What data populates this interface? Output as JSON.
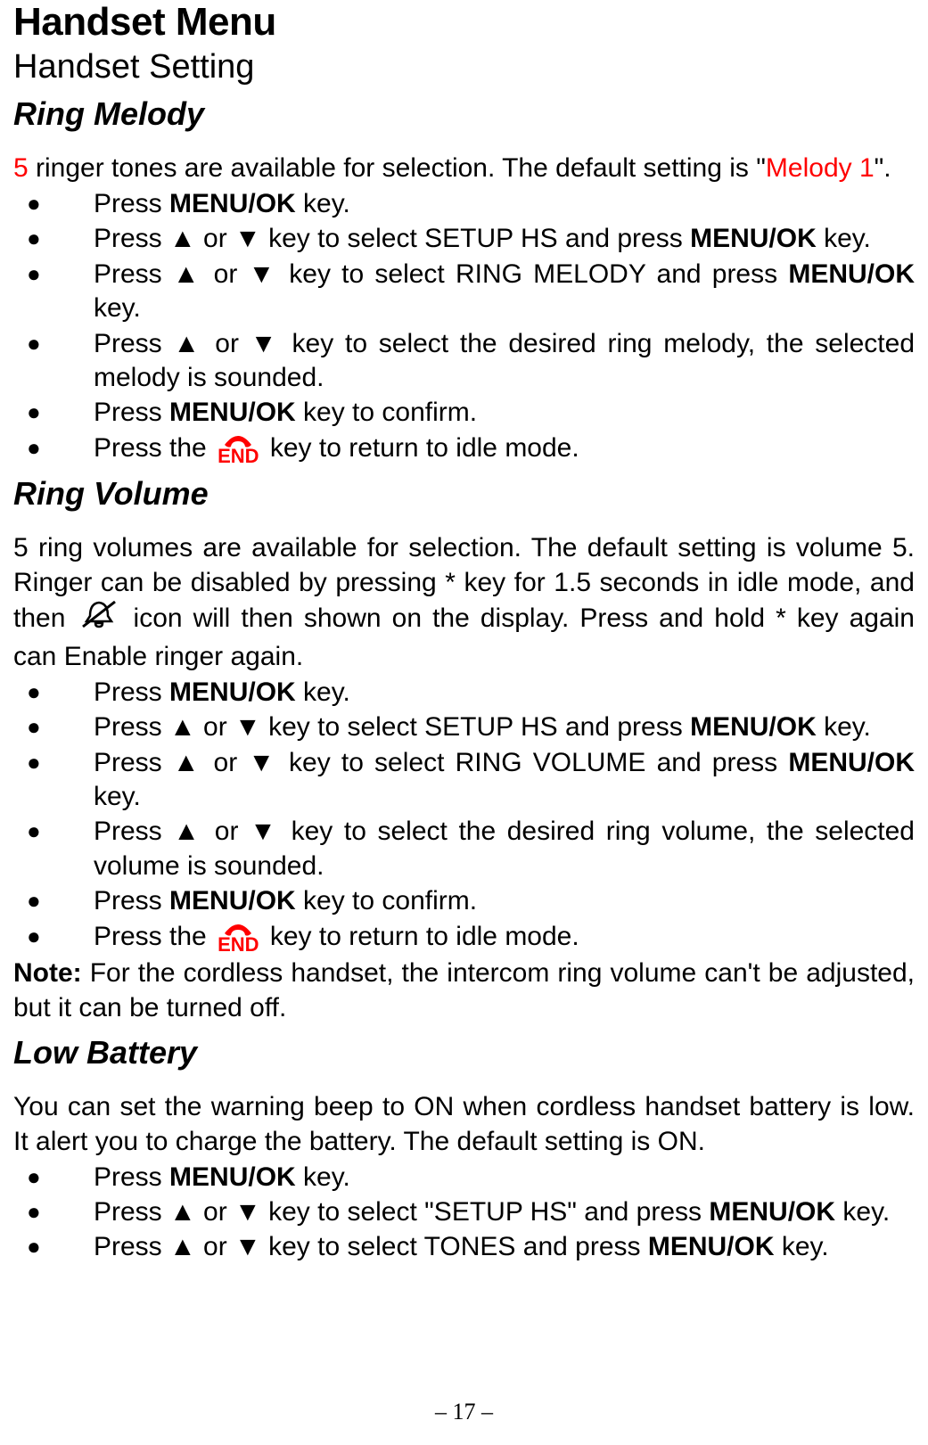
{
  "h1": "Handset Menu",
  "h2": "Handset Setting",
  "ring_melody": {
    "heading": "Ring Melody",
    "intro_count": "5",
    "intro_mid": " ringer tones are available for selection. The default setting is \"",
    "intro_default": "Melody 1",
    "intro_end": "\".",
    "items": {
      "i1_a": "Press ",
      "i1_b": "MENU/OK",
      "i1_c": " key.",
      "i2_a": "Press ▲ or ▼ key to select SETUP HS and press ",
      "i2_b": "MENU/OK",
      "i2_c": " key.",
      "i3_a": "Press ▲ or ▼ key to select RING MELODY and press ",
      "i3_b": "MENU/OK",
      "i3_c": " key.",
      "i4": "Press ▲ or ▼ key to select the desired ring melody, the selected melody is sounded.",
      "i5_a": "Press ",
      "i5_b": "MENU/OK",
      "i5_c": " key to confirm.",
      "i6_a": "Press the ",
      "i6_b": " key to return to idle mode."
    }
  },
  "ring_volume": {
    "heading": "Ring Volume",
    "intro_a": "5 ring volumes are available for selection. The default setting is volume 5. Ringer can be disabled by pressing * key for 1.5 seconds in idle mode, and then ",
    "intro_b": " icon will then shown on the display. Press and hold * key again can Enable ringer again.",
    "items": {
      "i1_a": "Press ",
      "i1_b": "MENU/OK",
      "i1_c": " key.",
      "i2_a": "Press ▲ or ▼ key to select SETUP HS and press ",
      "i2_b": "MENU/OK",
      "i2_c": " key.",
      "i3_a": "Press ▲ or ▼ key to select RING VOLUME and press ",
      "i3_b": "MENU/OK",
      "i3_c": " key.",
      "i4": "Press ▲ or ▼ key to select the desired ring volume, the selected volume is sounded.",
      "i5_a": "Press ",
      "i5_b": "MENU/OK",
      "i5_c": " key to confirm.",
      "i6_a": "Press the ",
      "i6_b": " key to return to idle mode."
    },
    "note_a": "Note:",
    "note_b": " For the cordless handset, the intercom ring volume can't be adjusted, but it can be turned off."
  },
  "low_battery": {
    "heading": "Low Battery",
    "intro": "You can set the warning beep to ON when cordless handset battery is low. It alert you to charge the battery. The default setting is ON.",
    "items": {
      "i1_a": "Press ",
      "i1_b": "MENU/OK",
      "i1_c": " key.",
      "i2_a": "Press ▲ or ▼ key to select \"SETUP HS\" and press ",
      "i2_b": "MENU/OK",
      "i2_c": " key.",
      "i3_a": "Press ▲ or ▼ key to select TONES and press ",
      "i3_b": "MENU/OK",
      "i3_c": " key."
    }
  },
  "end_key_label": "END",
  "page_number": "– 17 –"
}
